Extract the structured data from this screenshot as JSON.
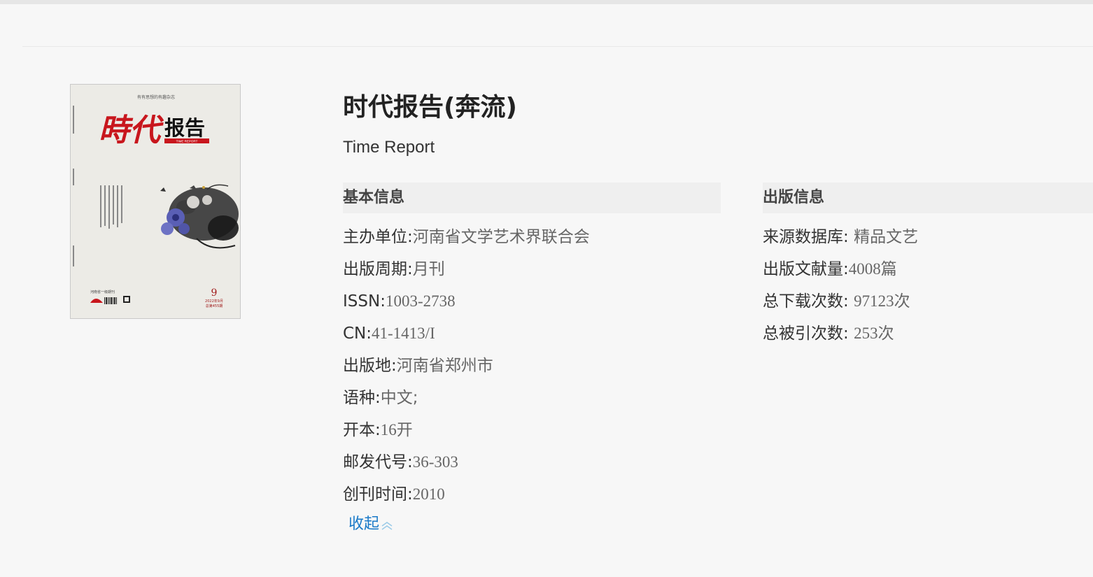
{
  "journal": {
    "title": "时代报告(奔流)",
    "english_title": "Time Report"
  },
  "cover": {
    "tagline": "有有思想的有趣杂志",
    "logo_char_1": "時",
    "logo_char_2": "代",
    "logo_char_3": "报告",
    "logo_sub": "TIME REPORT",
    "issue_number": "9",
    "issue_date": "2022年9月",
    "issue_total": "总第455期",
    "publisher_small": "河南省一级期刊"
  },
  "basic_info": {
    "heading": "基本信息",
    "fields": [
      {
        "label": "主办单位:",
        "value": "河南省文学艺术界联合会"
      },
      {
        "label": "出版周期:",
        "value": "月刊"
      },
      {
        "label": "ISSN:",
        "value": "1003-2738"
      },
      {
        "label": "CN:",
        "value": "41-1413/I"
      },
      {
        "label": "出版地:",
        "value": "河南省郑州市"
      },
      {
        "label": "语种:",
        "value": "中文;"
      },
      {
        "label": "开本:",
        "value": "16开"
      },
      {
        "label": "邮发代号:",
        "value": "36-303"
      },
      {
        "label": "创刊时间:",
        "value": "2010"
      }
    ],
    "collapse_label": "收起"
  },
  "publication_info": {
    "heading": "出版信息",
    "fields": [
      {
        "label": "来源数据库:",
        "value": "精品文艺"
      },
      {
        "label": "出版文献量:",
        "value": "4008篇"
      },
      {
        "label": "总下载次数:",
        "value": "97123次"
      },
      {
        "label": "总被引次数:",
        "value": "253次"
      }
    ]
  },
  "colors": {
    "link": "#1a7ac8",
    "heading_bg": "#efefef",
    "logo_red": "#c8161d"
  },
  "icons": {
    "collapse": "double-chevron-up-icon"
  }
}
